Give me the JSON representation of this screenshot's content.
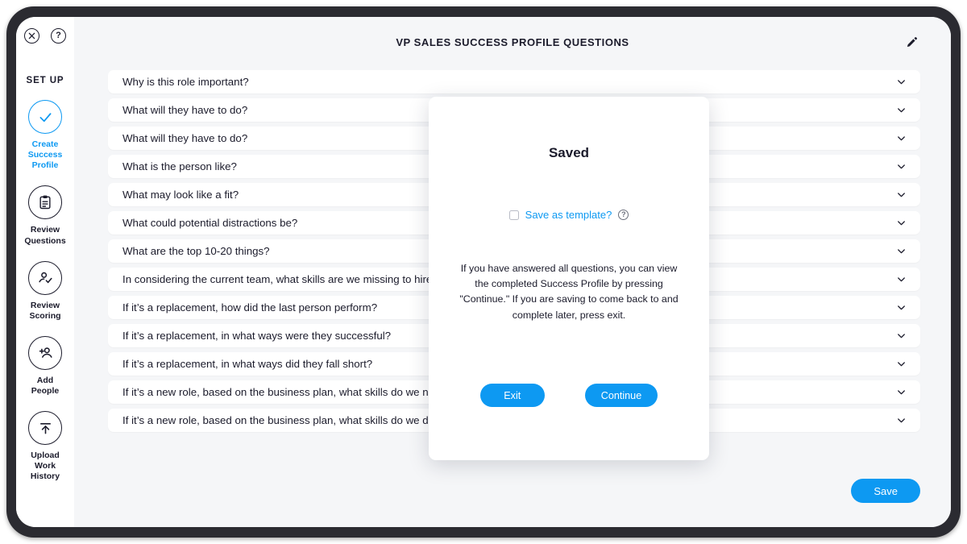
{
  "window_icons": [
    {
      "name": "close-icon",
      "glyph": "✕"
    },
    {
      "name": "help-icon",
      "glyph": "?"
    }
  ],
  "sidebar": {
    "section_label": "SET UP",
    "items": [
      {
        "label": "Create\nSuccess\nProfile",
        "icon": "check-circle-icon",
        "active": true
      },
      {
        "label": "Review\nQuestions",
        "icon": "clipboard-icon",
        "active": false
      },
      {
        "label": "Review\nScoring",
        "icon": "person-check-icon",
        "active": false
      },
      {
        "label": "Add\nPeople",
        "icon": "person-add-icon",
        "active": false
      },
      {
        "label": "Upload\nWork\nHistory",
        "icon": "upload-icon",
        "active": false
      }
    ]
  },
  "header": {
    "title": "VP SALES SUCCESS PROFILE QUESTIONS",
    "edit_icon": "pencil-icon"
  },
  "questions": [
    "Why is this role important?",
    "What will they have to do?",
    "What will they have to do?",
    "What is the person like?",
    "What may look like a fit?",
    "What could potential distractions be?",
    "What are the top 10-20 things?",
    "In considering the current team, what skills are we missing to hire?",
    "If it’s a replacement, how did the last person perform?",
    "If it’s a replacement, in what ways were they successful?",
    "If it’s a replacement, in what ways did they fall short?",
    "If it’s a new role, based on the business plan, what skills do we need?",
    "If it’s a new role, based on the business plan, what skills do we don’t want?"
  ],
  "footer": {
    "save_label": "Save"
  },
  "modal": {
    "title": "Saved",
    "checkbox_label": "Save as template?",
    "checkbox_checked": false,
    "help_icon": "help-icon",
    "body": "If you have answered all questions, you can view the completed Success Profile by pressing \"Continue.\" If you are saving to come back to and complete later, press exit.",
    "exit_label": "Exit",
    "continue_label": "Continue"
  },
  "colors": {
    "accent_blue": "#0d99f2",
    "ink": "#1b1b2b",
    "page_bg": "#f5f6f8",
    "frame": "#2b2b31"
  }
}
